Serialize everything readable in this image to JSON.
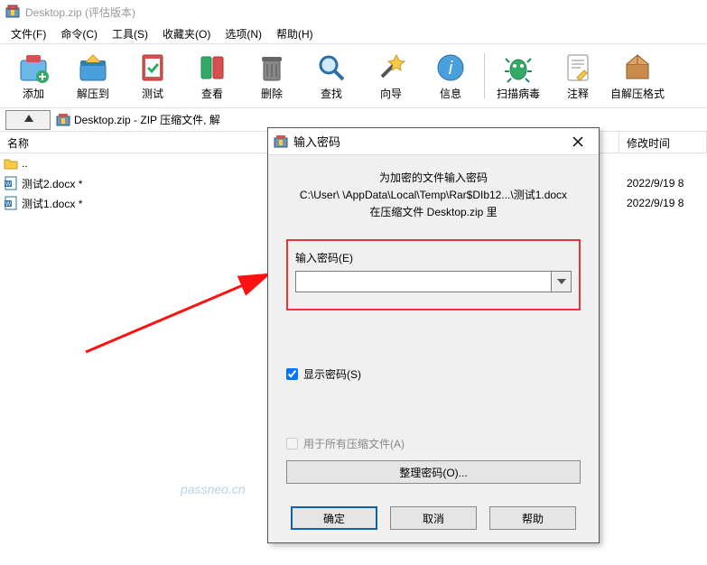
{
  "window": {
    "title": "Desktop.zip (评估版本)"
  },
  "menu": {
    "file": "文件(F)",
    "cmd": "命令(C)",
    "tools": "工具(S)",
    "fav": "收藏夹(O)",
    "opt": "选项(N)",
    "help": "帮助(H)"
  },
  "toolbar": {
    "add": "添加",
    "extract": "解压到",
    "test": "测试",
    "view": "查看",
    "delete": "删除",
    "find": "查找",
    "wizard": "向导",
    "info": "信息",
    "scan": "扫描病毒",
    "comment": "注释",
    "sfx": "自解压格式"
  },
  "path": {
    "text": "Desktop.zip - ZIP 压缩文件, 解"
  },
  "columns": {
    "name": "名称",
    "date": "修改时间"
  },
  "files": {
    "up": "..",
    "r1": {
      "name": "测试2.docx *",
      "date": "2022/9/19 8"
    },
    "r2": {
      "name": "测试1.docx *",
      "date": "2022/9/19 8"
    }
  },
  "dialog": {
    "title": "输入密码",
    "l1": "为加密的文件输入密码",
    "l2": "C:\\User\\             \\AppData\\Local\\Temp\\Rar$DIb12...\\测试1.docx",
    "l3": "在压缩文件 Desktop.zip 里",
    "pwlabel": "输入密码(E)",
    "pwvalue": "",
    "show": "显示密码(S)",
    "useall": "用于所有压缩文件(A)",
    "organize": "整理密码(O)...",
    "ok": "确定",
    "cancel": "取消",
    "help": "帮助",
    "show_checked": true,
    "useall_checked": false
  },
  "watermark": "passneo.cn"
}
